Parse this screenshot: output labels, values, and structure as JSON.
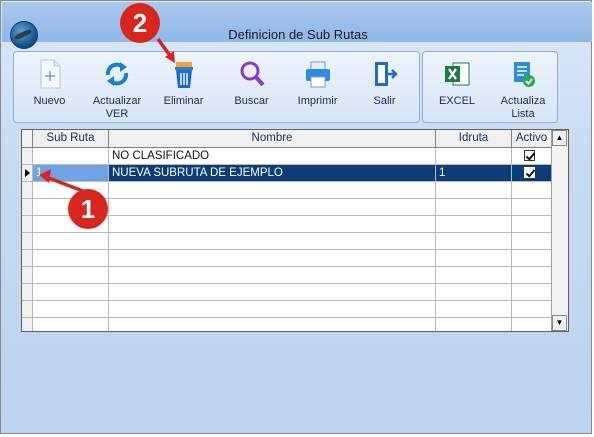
{
  "window": {
    "title": "Definicion de Sub Rutas"
  },
  "toolbar": {
    "nuevo": "Nuevo",
    "actualizar": "Actualizar VER",
    "eliminar": "Eliminar",
    "buscar": "Buscar",
    "imprimir": "Imprimir",
    "salir": "Salir",
    "excel": "EXCEL",
    "actualiza_lista": "Actualiza Lista"
  },
  "grid": {
    "columns": [
      "Sub Ruta",
      "Nombre",
      "Idruta",
      "Activo"
    ],
    "rows": [
      {
        "sub_ruta": "",
        "nombre": "NO CLASIFICADO",
        "idruta": "",
        "activo": true
      },
      {
        "sub_ruta": "1",
        "nombre": "NUEVA SUBRUTA DE EJEMPLO",
        "idruta": "1",
        "activo": true
      }
    ],
    "selected_row": 1
  },
  "annotations": {
    "badge_1": "1",
    "badge_2": "2"
  },
  "colors": {
    "selection": "#0c3d78",
    "annotation": "#d8261f"
  }
}
